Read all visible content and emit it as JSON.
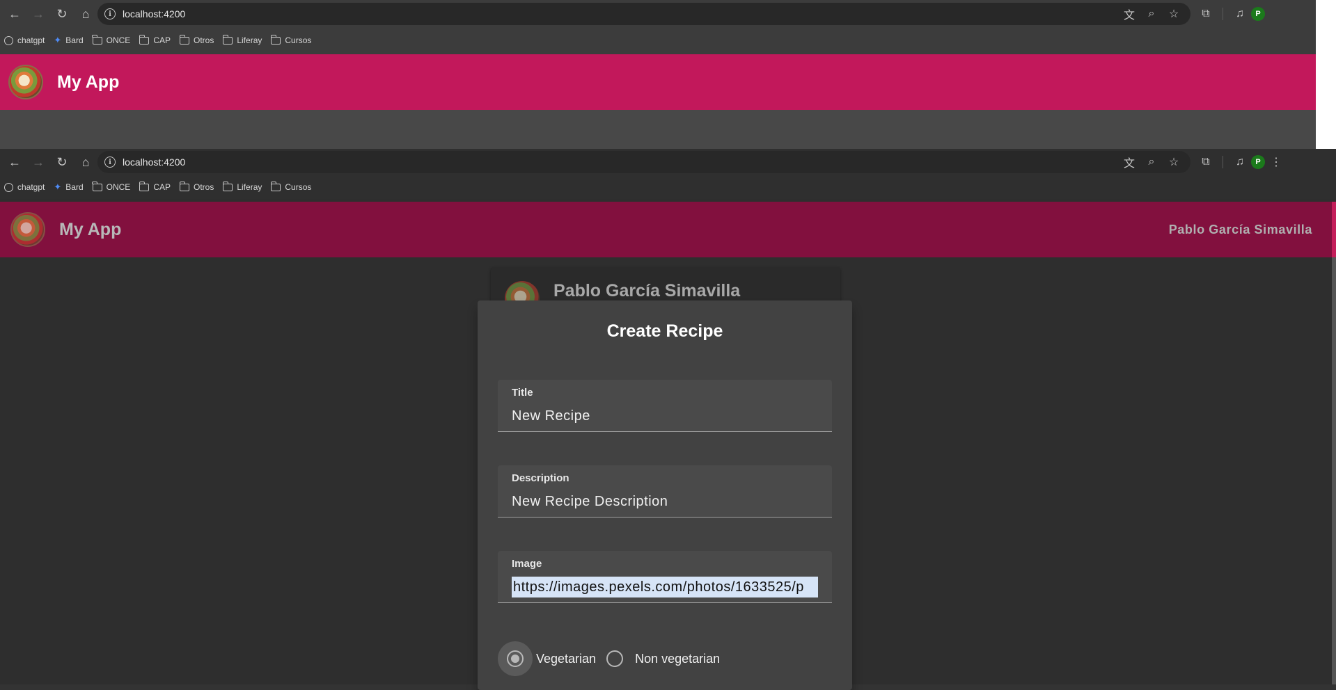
{
  "back_window": {
    "url": "localhost:4200",
    "bookmarks": [
      {
        "label": "chatgpt",
        "icon": "chatgpt-icon"
      },
      {
        "label": "Bard",
        "icon": "bard-icon"
      },
      {
        "label": "ONCE",
        "icon": "folder-icon"
      },
      {
        "label": "CAP",
        "icon": "folder-icon"
      },
      {
        "label": "Otros",
        "icon": "folder-icon"
      },
      {
        "label": "Liferay",
        "icon": "folder-icon"
      },
      {
        "label": "Cursos",
        "icon": "folder-icon"
      }
    ],
    "app_title": "My App",
    "profile_initial": "P",
    "toolbar_color": "#c2185b"
  },
  "front_window": {
    "url": "localhost:4200",
    "bookmarks": [
      {
        "label": "chatgpt",
        "icon": "chatgpt-icon"
      },
      {
        "label": "Bard",
        "icon": "bard-icon"
      },
      {
        "label": "ONCE",
        "icon": "folder-icon"
      },
      {
        "label": "CAP",
        "icon": "folder-icon"
      },
      {
        "label": "Otros",
        "icon": "folder-icon"
      },
      {
        "label": "Liferay",
        "icon": "folder-icon"
      },
      {
        "label": "Cursos",
        "icon": "folder-icon"
      }
    ],
    "app_title": "My App",
    "user_name": "Pablo García Simavilla",
    "profile_initial": "P",
    "profile_card": {
      "name": "Pablo García Simavilla"
    },
    "dialog": {
      "title": "Create Recipe",
      "fields": {
        "title": {
          "label": "Title",
          "value": "New Recipe"
        },
        "description": {
          "label": "Description",
          "value": "New Recipe Description"
        },
        "image": {
          "label": "Image",
          "value": "https://images.pexels.com/photos/1633525/p"
        }
      },
      "radio": {
        "vegetarian": {
          "label": "Vegetarian",
          "checked": true
        },
        "non_vegetarian": {
          "label": "Non vegetarian",
          "checked": false
        }
      }
    },
    "toolbar_color": "#82103e"
  }
}
